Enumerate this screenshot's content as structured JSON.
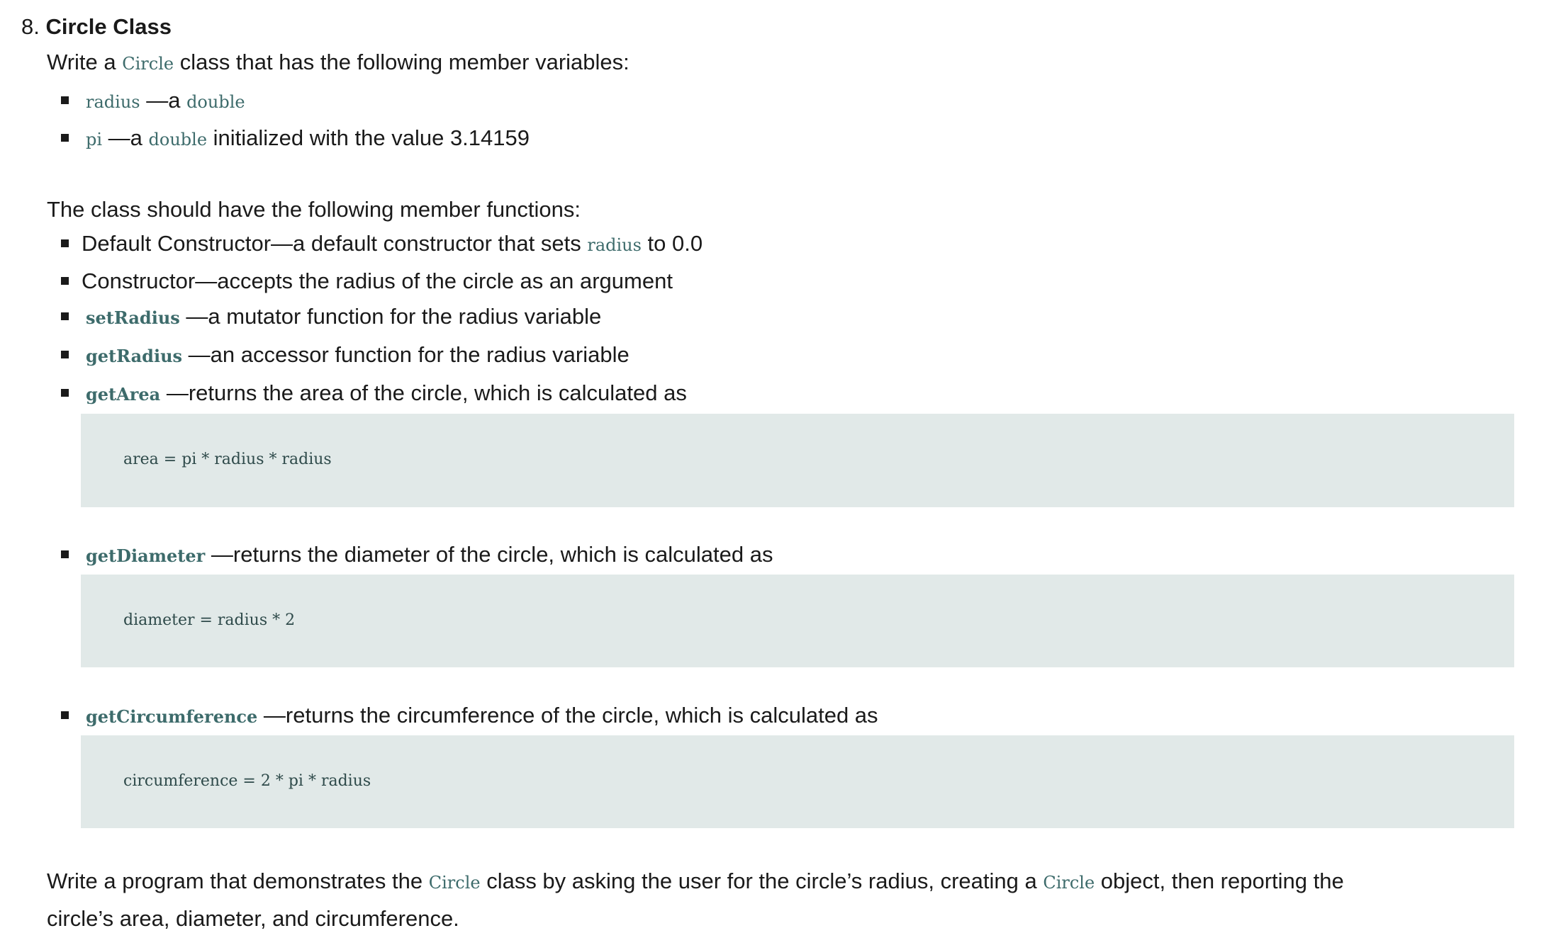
{
  "section": {
    "number": "8.",
    "title": "Circle Class"
  },
  "intro": {
    "pre": "Write a ",
    "code": "Circle",
    "post": " class that has the following member variables:"
  },
  "variables": [
    {
      "name": "radius",
      "sep": " —a ",
      "type": "double",
      "rest": ""
    },
    {
      "name": "pi",
      "sep": " —a ",
      "type": "double",
      "rest": " initialized with the value 3.14159"
    }
  ],
  "functions_heading": "The class should have the following member functions:",
  "functions": {
    "default_ctor": {
      "text": "Default Constructor—a default constructor that sets ",
      "code": "radius",
      "post": " to 0.0"
    },
    "ctor": {
      "text": "Constructor—accepts the radius of the circle as an argument"
    },
    "set_radius": {
      "code": "setRadius",
      "text": " —a mutator function for the radius variable"
    },
    "get_radius": {
      "code": "getRadius",
      "text": " —an accessor function for the radius variable"
    },
    "get_area": {
      "code": "getArea",
      "text": " —returns the area of the circle, which is calculated as",
      "formula": "area = pi * radius * radius"
    },
    "get_diameter": {
      "code": "getDiameter",
      "text": " —returns the diameter of the circle, which is calculated as",
      "formula": "diameter = radius * 2"
    },
    "get_circumference": {
      "code": "getCircumference",
      "text": " —returns the circumference of the circle, which is calculated as",
      "formula": "circumference = 2 * pi * radius"
    }
  },
  "closing": {
    "part1": "Write a program that demonstrates the ",
    "code1": "Circle",
    "part2": " class by asking the user for the circle’s radius, creating a ",
    "code2": "Circle",
    "part3": " object, then reporting the",
    "line2": "circle’s area, diameter, and circumference."
  }
}
